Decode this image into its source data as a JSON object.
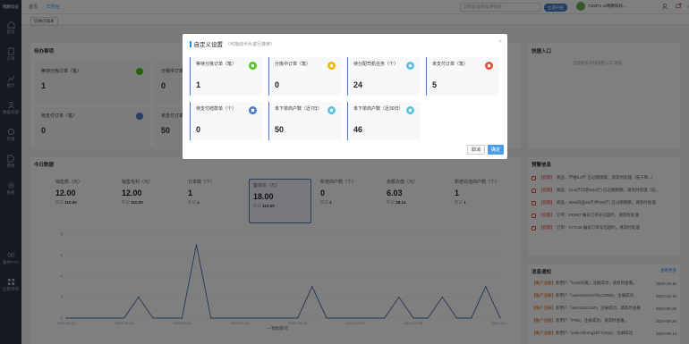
{
  "sidebar": {
    "logo": "锦鹏科技",
    "items": [
      {
        "label": "首页"
      },
      {
        "label": "订单"
      },
      {
        "label": "统计"
      },
      {
        "label": "数据权限"
      },
      {
        "label": "货源"
      },
      {
        "label": "营销"
      },
      {
        "label": "系统"
      },
      {
        "label": "备件PVC"
      },
      {
        "label": "应用市场"
      }
    ]
  },
  "header": {
    "nav": [
      "首页",
      "工作台"
    ],
    "search_placeholder": "订单号/运单号/手机号",
    "upgrade_label": "立即升级",
    "user": "T10071 xs锦鹏科技..."
  },
  "page_tab": "切换店铺本",
  "todo": {
    "title": "待办事项"
  },
  "bg_todo_cards": [
    {
      "label": "等待分拣订单（笔）",
      "value": "1"
    },
    {
      "label": "分拣中订单（笔）",
      "value": "0"
    },
    {
      "label": "待支付订单（笔）",
      "value": "0"
    },
    {
      "label": "未支付订单（笔）",
      "value": "50"
    }
  ],
  "quick": {
    "title": "快捷入口",
    "empty": "当前暂未添加快捷入口 添加"
  },
  "today": {
    "title": "今日数据",
    "stats": [
      {
        "label": "销售额（元）",
        "value": "12.00",
        "sub_label": "昨日",
        "sub_value": "110.00"
      },
      {
        "label": "销售毛利（元）",
        "value": "12.00",
        "sub_label": "昨日",
        "sub_value": "110.00"
      },
      {
        "label": "订单数（个）",
        "value": "1",
        "sub_label": "昨日",
        "sub_value": "1"
      },
      {
        "label": "客单价（元）",
        "value": "18.00",
        "sub_label": "昨日",
        "sub_value": "110.00"
      },
      {
        "label": "新增商户数（个）",
        "value": "0",
        "sub_label": "昨日",
        "sub_value": "1"
      },
      {
        "label": "余额充值（元）",
        "value": "6.03",
        "sub_label": "昨日",
        "sub_value": "28.14"
      },
      {
        "label": "新增充值商户数（个）",
        "value": "1",
        "sub_label": "昨日",
        "sub_value": "1"
      }
    ]
  },
  "warn": {
    "title": "预警信息",
    "items": [
      {
        "tag": "【提醒】",
        "text": "商品：芦柑5.0斤 已过期限额，请及时处理（低于库...）"
      },
      {
        "tag": "【提醒】",
        "text": "商品：10.5斤口感25(4斤) 已过期限额，请及时处理（低..."
      },
      {
        "tag": "【提醒】",
        "text": "商品：60ml商品50斤/件(50斤) 已过期限额，请及时处理"
      },
      {
        "tag": "【提醒】",
        "text": "订单：DD987 编号订单号已超时，请及时处理"
      },
      {
        "tag": "【提醒】",
        "text": "订单：177245 编号订单号已超时，请及时处理"
      }
    ]
  },
  "notice": {
    "title": "消息通知",
    "more": "查看更多",
    "items": [
      {
        "type": "【账户注册】",
        "text": "新用户「hs48天跳」注册成功，请及时查看。",
        "date": "2024-10-11"
      },
      {
        "type": "【账户注册】",
        "text": "新用户「aa4n2m6c2r7byc236kk」注册成功",
        "date": "2024-10-10"
      },
      {
        "type": "【账户注册】",
        "text": "新用户「amm3322100」注册成功，请及时查看",
        "date": "2024-09-28"
      },
      {
        "type": "【账户注册】",
        "text": "新用户「PRE」注册成功，请及时查看。",
        "date": "2024-09-20"
      },
      {
        "type": "【账户注册】",
        "text": "新用户「pnkrY6hong2hT7oGpe」注册成功",
        "date": "2024-09-13"
      }
    ]
  },
  "chart_data": {
    "type": "line",
    "x": [
      "2024-09-12",
      "",
      "",
      "",
      "2024-09-16",
      "",
      "",
      "",
      "2024-09-20",
      "",
      "",
      "",
      "2024-09-24",
      "",
      "",
      "",
      "2024-09-28",
      "",
      "",
      "",
      "2024-10-02",
      "",
      "",
      "",
      "2024-10-06",
      "",
      "",
      "",
      "2024-10-10",
      "",
      "2024-10-12"
    ],
    "values": [
      0,
      0,
      0,
      0,
      0,
      2,
      0,
      0,
      0,
      7,
      0,
      0,
      0,
      0,
      0,
      0,
      0,
      3,
      0,
      0,
      0,
      0,
      0,
      2,
      0,
      0,
      2,
      0,
      0,
      3,
      0
    ],
    "tick_labels": [
      "2024-09-12",
      "2024-09-16",
      "2024-09-20",
      "2024-09-24",
      "2024-09-28",
      "2024-10-02",
      "2024-10-06",
      "2024-10-12"
    ],
    "ylim": [
      0,
      8
    ],
    "y_ticks": [
      "0",
      "2",
      "4",
      "6",
      "8"
    ],
    "legend": "销售额/元"
  },
  "modal": {
    "title": "自定义设置",
    "hint": "（可拖动卡片进行排序）",
    "close": "×",
    "cards": [
      {
        "label": "等待分拣订单（笔）",
        "value": "1",
        "color": "#52c41a"
      },
      {
        "label": "分拣中订单（笔）",
        "value": "0",
        "color": "#f0b400"
      },
      {
        "label": "待分配司机任务（个）",
        "value": "24",
        "color": "#5bc0de"
      },
      {
        "label": "未支付订单（笔）",
        "value": "5",
        "color": "#e74c3c"
      },
      {
        "label": "待支付结款单（个）",
        "value": "0",
        "color": "#4a7ec4"
      },
      {
        "label": "未下单商户数（近7日）",
        "value": "50",
        "color": "#5bc0de"
      },
      {
        "label": "未下单商户数（近30日）",
        "value": "46",
        "color": "#5bc0de"
      }
    ],
    "cancel": "取消",
    "ok": "确定"
  }
}
